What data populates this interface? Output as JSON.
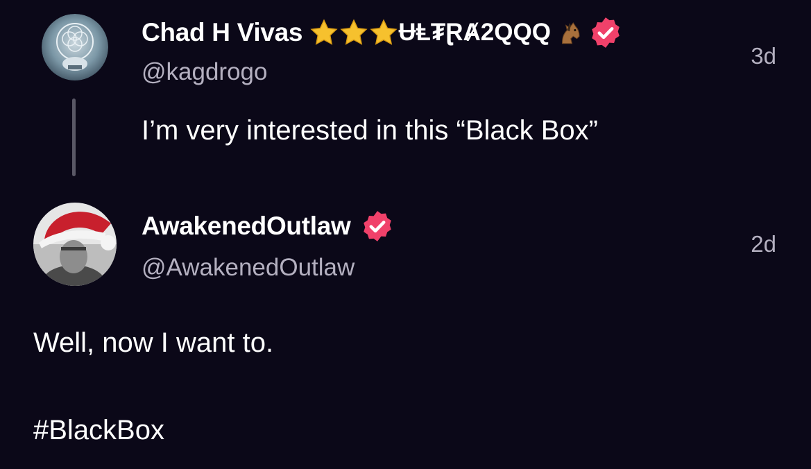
{
  "posts": [
    {
      "display_name": "Chad H Vivas",
      "name_suffix": "ɄⱠ₮ⱤȺ2QQQ",
      "name_emojis": [
        "star-icon",
        "star-icon",
        "star-icon",
        "horse-icon"
      ],
      "handle": "@kagdrogo",
      "timestamp": "3d",
      "text": "I’m very interested in this “Black Box”",
      "verified": true,
      "avatar": "steal-your-face-skull-avatar"
    },
    {
      "display_name": "AwakenedOutlaw",
      "handle": "@AwakenedOutlaw",
      "timestamp": "2d",
      "text_line1": "Well, now I want to.",
      "text_line2": "#BlackBox",
      "verified": true,
      "avatar": "santa-hat-cowboy-avatar"
    }
  ],
  "colors": {
    "background": "#0b0818",
    "verified_badge": "#f0416a",
    "handle_text": "#b4b0c0",
    "star": "#f6c12e"
  }
}
